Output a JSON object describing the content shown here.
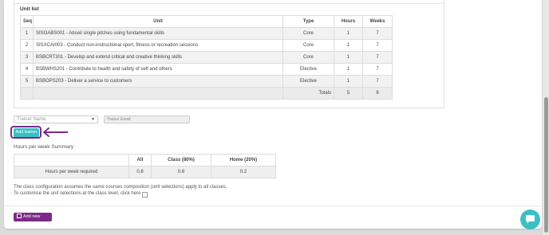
{
  "unit_list": {
    "title": "Unit list",
    "headers": [
      "Seq",
      "Unit",
      "Type",
      "Hours",
      "Weeks"
    ],
    "rows": [
      {
        "seq": "1",
        "unit": "SISOABS001 - Abseil single pitches using fundamental skills",
        "type": "Core",
        "hours": "1",
        "weeks": "7"
      },
      {
        "seq": "2",
        "unit": "SISXCAI003 - Conduct non-instructional sport, fitness or recreation sessions",
        "type": "Core",
        "hours": "1",
        "weeks": "7"
      },
      {
        "seq": "3",
        "unit": "BSBCRT301 - Develop and extend critical and creative thinking skills",
        "type": "Core",
        "hours": "1",
        "weeks": "7"
      },
      {
        "seq": "4",
        "unit": "BSBWHS201 - Contribute to health and safety of self and others",
        "type": "Elective",
        "hours": "1",
        "weeks": "7"
      },
      {
        "seq": "5",
        "unit": "BSBOPS203 - Deliver a service to customers",
        "type": "Elective",
        "hours": "1",
        "weeks": "7"
      }
    ],
    "totals": {
      "label": "Totals",
      "hours": "5",
      "weeks": "6"
    }
  },
  "trainer": {
    "name_placeholder": "Trainer Name",
    "email_placeholder": "Trainer Email",
    "add_label": "Add trainer"
  },
  "summary": {
    "title": "Hours per week Summary",
    "headers": [
      "",
      "All",
      "Class (80%)",
      "Home (20%)"
    ],
    "row": {
      "label": "Hours per week required",
      "all": "0.8",
      "class": "0.6",
      "home": "0.2"
    }
  },
  "notes": {
    "line1": "The class configuration assumes the same courses composition (unit selections) apply to all classes.",
    "line2": "To customise the unit selections at the class level, click here"
  },
  "add_class_label": "Add new Class",
  "colors": {
    "teal": "#3bbfc4",
    "purple": "#7b2a86"
  }
}
